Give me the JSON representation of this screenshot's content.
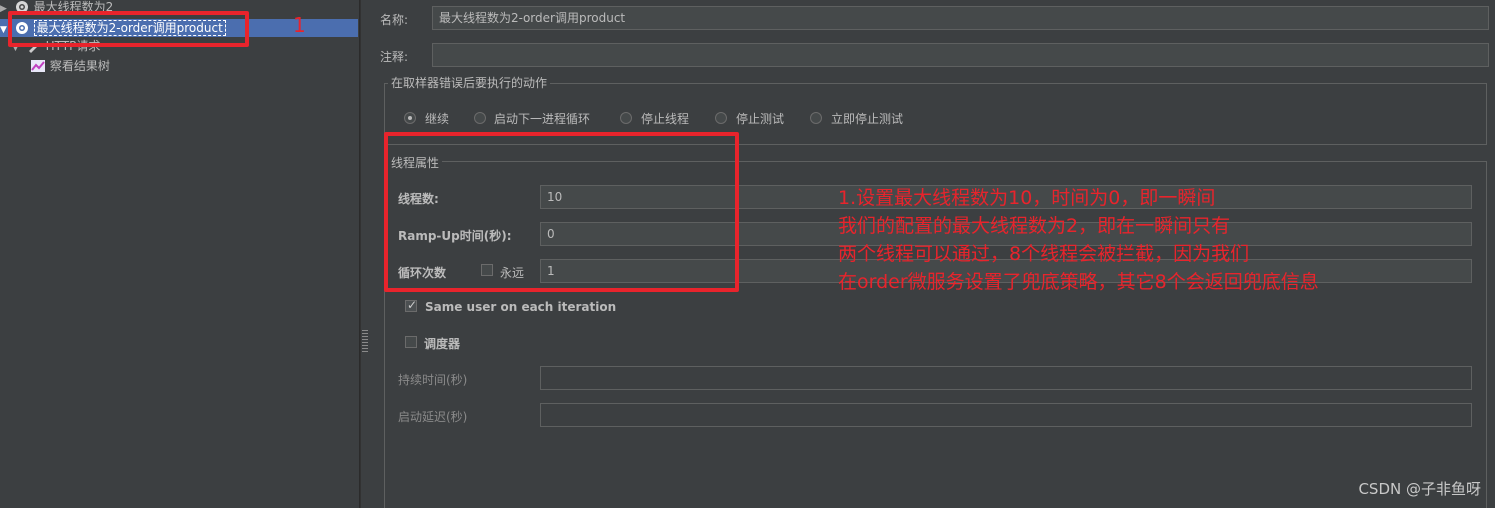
{
  "tree": {
    "items": [
      {
        "label": "最大线程数为2",
        "icon": "gear-icon"
      },
      {
        "label": "最大线程数为2-order调用product",
        "icon": "gear-icon",
        "selected": true
      },
      {
        "label": "HTTP请求",
        "icon": "pencil-icon"
      },
      {
        "label": "察看结果树",
        "icon": "chart-icon"
      }
    ]
  },
  "form": {
    "name_label": "名称:",
    "name_value": "最大线程数为2-order调用product",
    "comment_label": "注释:",
    "comment_value": ""
  },
  "sampler_error": {
    "title": "在取样器错误后要执行的动作",
    "options": [
      "继续",
      "启动下一进程循环",
      "停止线程",
      "停止测试",
      "立即停止测试"
    ],
    "selected": "继续"
  },
  "thread_props": {
    "title": "线程属性",
    "threads_label": "线程数:",
    "threads_value": "10",
    "rampup_label": "Ramp-Up时间(秒):",
    "rampup_value": "0",
    "loop_label": "循环次数",
    "forever_label": "永远",
    "loop_value": "1",
    "same_user_label": "Same user on each iteration",
    "same_user_checked": true,
    "scheduler_label": "调度器",
    "scheduler_checked": false,
    "duration_label": "持续时间(秒)",
    "duration_value": "",
    "delay_label": "启动延迟(秒)",
    "delay_value": ""
  },
  "annotations": {
    "marker": "1",
    "note_lines": [
      "1.设置最大线程数为10，时间为0，即一瞬间",
      "我们的配置的最大线程数为2，即在一瞬间只有",
      "两个线程可以通过，8个线程会被拦截，因为我们",
      "在order微服务设置了兜底策略，其它8个会返回兜底信息"
    ],
    "color": "#e8242c"
  },
  "watermark": "CSDN @子非鱼呀",
  "colors": {
    "background": "#3c3f41",
    "selection": "#4b6eaf",
    "field": "#45494a"
  }
}
